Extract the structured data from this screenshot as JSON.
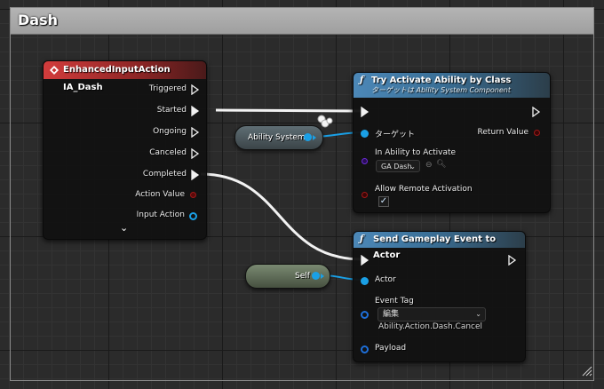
{
  "comment": {
    "title": "Dash"
  },
  "event_node": {
    "title": "EnhancedInputAction IA_Dash",
    "pins": [
      "Triggered",
      "Started",
      "Ongoing",
      "Canceled",
      "Completed",
      "Action Value",
      "Input Action"
    ],
    "expand_glyph": "⌄"
  },
  "activate_node": {
    "title": "Try Activate Ability by Class",
    "subtitle": "ターゲットは Ability System Component",
    "target_label": "ターゲット",
    "return_label": "Return Value",
    "ability_label": "In Ability to Activate",
    "ability_value": "GA Dash",
    "remote_label": "Allow Remote Activation",
    "remote_checked": "✓"
  },
  "asc_var": {
    "label": "Ability System"
  },
  "self_var": {
    "label": "Self"
  },
  "send_node": {
    "title": "Send Gameplay Event to Actor",
    "actor_label": "Actor",
    "tag_label": "Event Tag",
    "tag_combo": "編集",
    "tag_value": "Ability.Action.Dash.Cancel",
    "payload_label": "Payload"
  },
  "colors": {
    "exec": "#f0f0f0",
    "object_pin": "#1aa0e6",
    "struct_pin": "#1e6fd9",
    "class_pin": "#6a2bd8",
    "value_pin": "#a01818",
    "event_header": "#c83232",
    "function_header": "#4c88b8"
  },
  "icons": [
    "event-diamond-icon",
    "function-icon",
    "chevron-down-icon",
    "browse-arrow-icon",
    "search-icon",
    "resize-grip-icon"
  ]
}
